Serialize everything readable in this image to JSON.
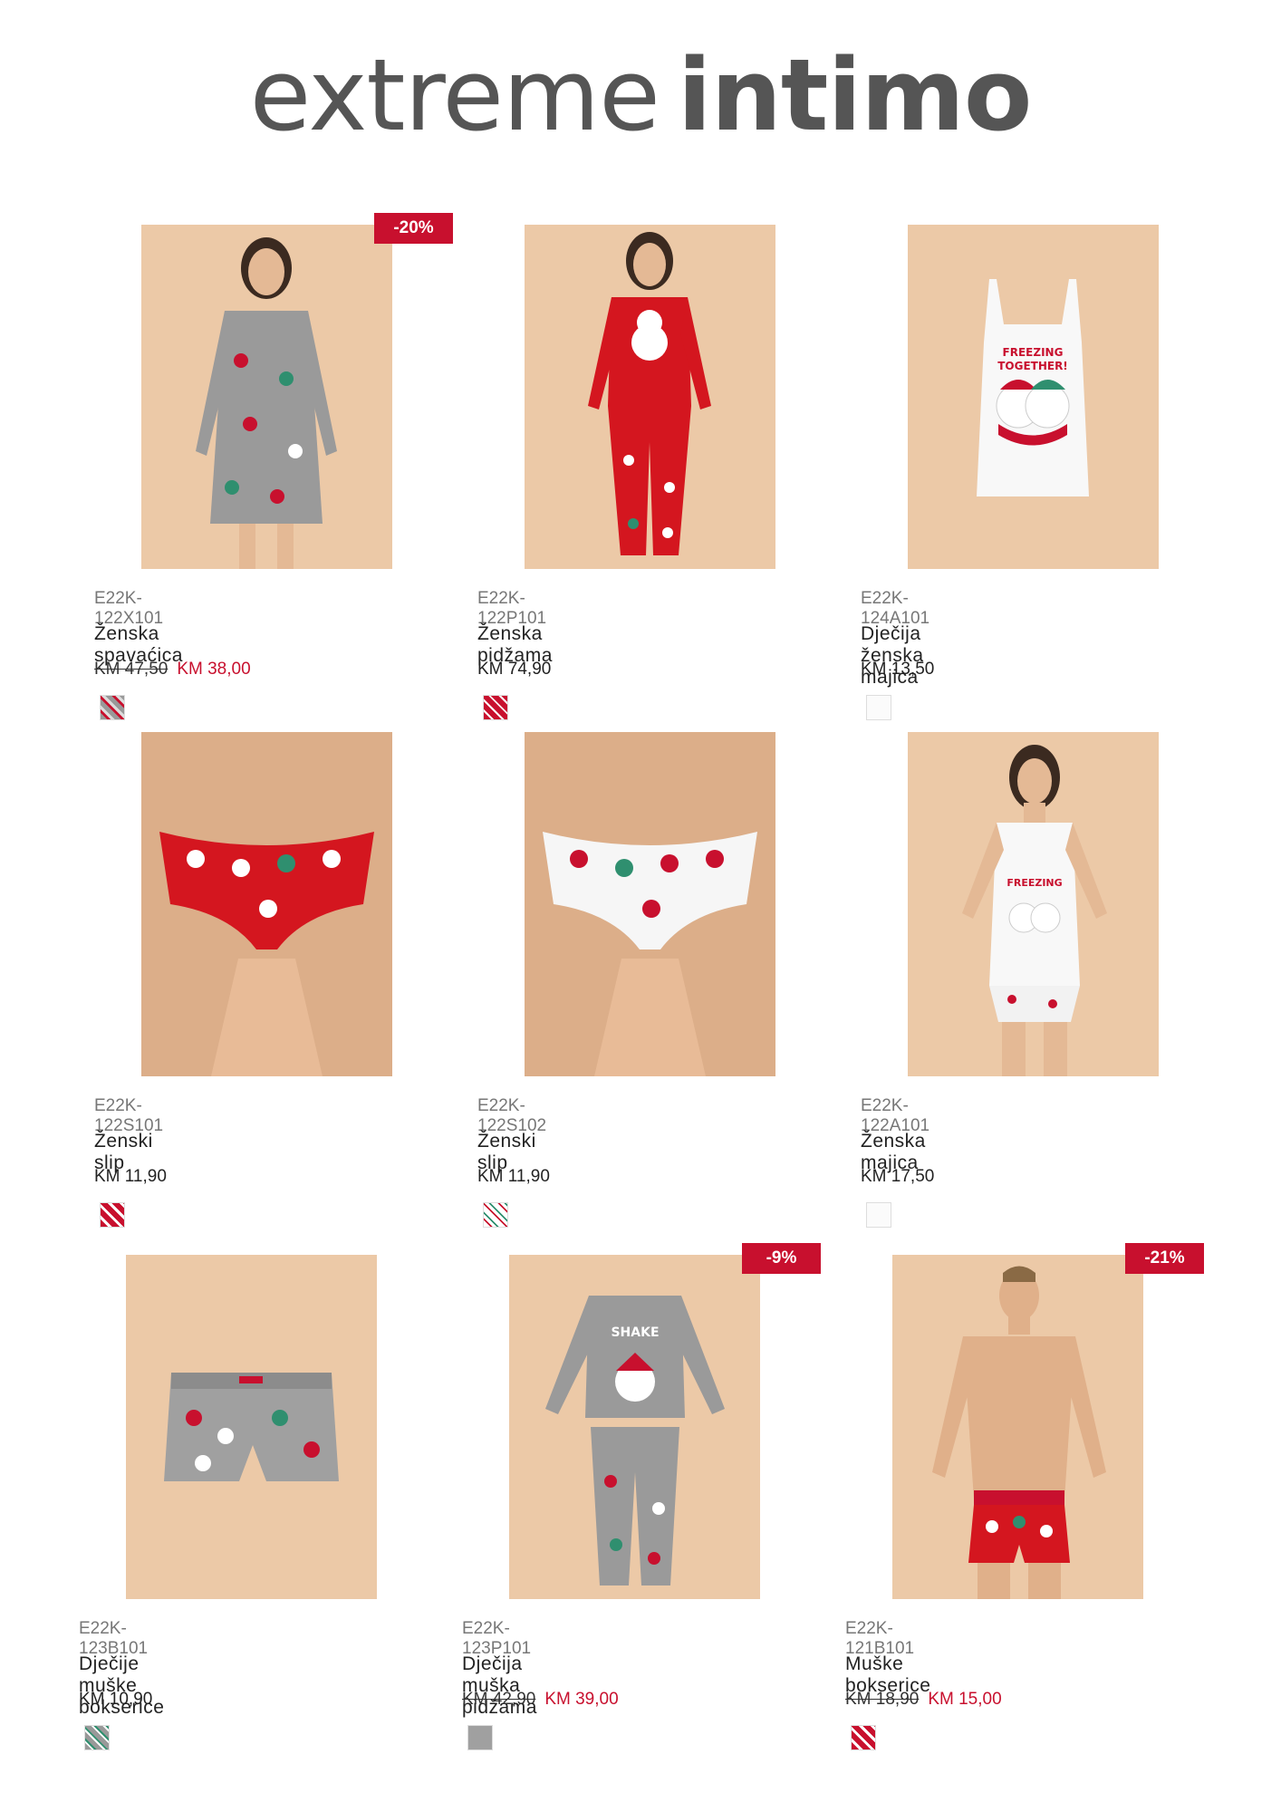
{
  "brand": {
    "light": "extreme",
    "bold": "intimo"
  },
  "colors": {
    "accent": "#c8102e",
    "background": "#ecc9a7"
  },
  "products": [
    {
      "sku": "E22K-122X101",
      "name": "Ženska spavaćica",
      "price_old": "KM 47,50",
      "price": "KM 38,00",
      "badge": "-20%",
      "swatch": "grey-snowman-print"
    },
    {
      "sku": "E22K-122P101",
      "name": "Ženska pidžama",
      "price": "KM 74,90",
      "swatch": "red-snowman-print"
    },
    {
      "sku": "E22K-124A101",
      "name": "Dječija ženska majica",
      "price": "KM 13,50",
      "swatch": "white"
    },
    {
      "sku": "E22K-122S101",
      "name": "Ženski slip",
      "price": "KM 11,90",
      "swatch": "red-snowman-print"
    },
    {
      "sku": "E22K-122S102",
      "name": "Ženski slip",
      "price": "KM 11,90",
      "swatch": "white-snowman-print"
    },
    {
      "sku": "E22K-122A101",
      "name": "Ženska majica",
      "price": "KM 17,50",
      "swatch": "white"
    },
    {
      "sku": "E22K-123B101",
      "name": "Dječije muške bokserice",
      "price": "KM 10,90",
      "swatch": "grey-snowman-print"
    },
    {
      "sku": "E22K-123P101",
      "name": "Dječija muška pidžama",
      "price_old": "KM 42,90",
      "price": "KM 39,00",
      "badge": "-9%",
      "swatch": "grey"
    },
    {
      "sku": "E22K-121B101",
      "name": "Muške bokserice",
      "price_old": "KM 18,90",
      "price": "KM 15,00",
      "badge": "-21%",
      "swatch": "red-snowman-print"
    }
  ]
}
